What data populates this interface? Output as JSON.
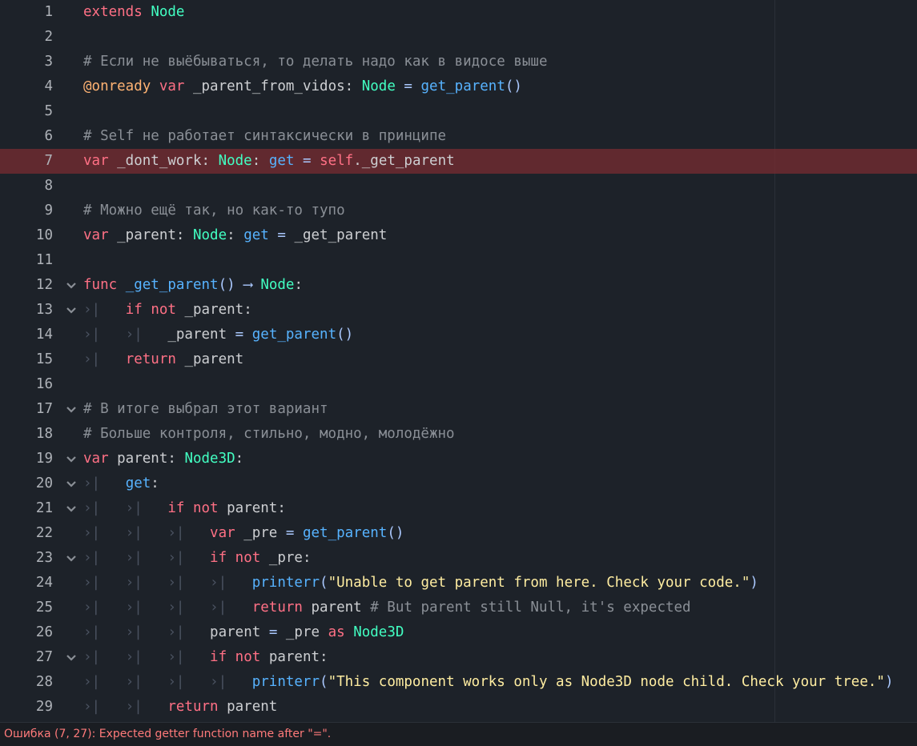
{
  "editor": {
    "lines": [
      {
        "num": "1",
        "fold": false,
        "error": false,
        "tokens": [
          [
            "kw",
            "extends"
          ],
          [
            "plain",
            " "
          ],
          [
            "type",
            "Node"
          ]
        ]
      },
      {
        "num": "2",
        "fold": false,
        "error": false,
        "tokens": []
      },
      {
        "num": "3",
        "fold": false,
        "error": false,
        "tokens": [
          [
            "cm",
            "# Если не выёбываться, то делать надо как в видосе выше"
          ]
        ]
      },
      {
        "num": "4",
        "fold": false,
        "error": false,
        "tokens": [
          [
            "anno",
            "@onready"
          ],
          [
            "plain",
            " "
          ],
          [
            "kw",
            "var"
          ],
          [
            "plain",
            " _parent_from_vidos: "
          ],
          [
            "type",
            "Node"
          ],
          [
            "plain",
            " "
          ],
          [
            "pn",
            "="
          ],
          [
            "plain",
            " "
          ],
          [
            "fn",
            "get_parent"
          ],
          [
            "pn",
            "()"
          ]
        ]
      },
      {
        "num": "5",
        "fold": false,
        "error": false,
        "tokens": []
      },
      {
        "num": "6",
        "fold": false,
        "error": false,
        "tokens": [
          [
            "cm",
            "# Self не работает синтаксически в принципе"
          ]
        ]
      },
      {
        "num": "7",
        "fold": false,
        "error": true,
        "tokens": [
          [
            "kw",
            "var"
          ],
          [
            "plain",
            " _dont_work: "
          ],
          [
            "type",
            "Node"
          ],
          [
            "plain",
            ": "
          ],
          [
            "getkw",
            "get"
          ],
          [
            "plain",
            " "
          ],
          [
            "pn",
            "="
          ],
          [
            "plain",
            " "
          ],
          [
            "selfkw",
            "self"
          ],
          [
            "plain",
            "._get_parent"
          ]
        ]
      },
      {
        "num": "8",
        "fold": false,
        "error": false,
        "tokens": []
      },
      {
        "num": "9",
        "fold": false,
        "error": false,
        "tokens": [
          [
            "cm",
            "# Можно ещё так, но как-то тупо"
          ]
        ]
      },
      {
        "num": "10",
        "fold": false,
        "error": false,
        "tokens": [
          [
            "kw",
            "var"
          ],
          [
            "plain",
            " _parent: "
          ],
          [
            "type",
            "Node"
          ],
          [
            "plain",
            ": "
          ],
          [
            "getkw",
            "get"
          ],
          [
            "plain",
            " "
          ],
          [
            "pn",
            "="
          ],
          [
            "plain",
            " _get_parent"
          ]
        ]
      },
      {
        "num": "11",
        "fold": false,
        "error": false,
        "tokens": []
      },
      {
        "num": "12",
        "fold": true,
        "error": false,
        "tokens": [
          [
            "kw",
            "func"
          ],
          [
            "plain",
            " "
          ],
          [
            "fn",
            "_get_parent"
          ],
          [
            "pn",
            "()"
          ],
          [
            "plain",
            " "
          ],
          [
            "pn",
            "⟶"
          ],
          [
            "plain",
            " "
          ],
          [
            "type",
            "Node"
          ],
          [
            "plain",
            ":"
          ]
        ]
      },
      {
        "num": "13",
        "fold": true,
        "error": false,
        "tokens": [
          [
            "tab",
            "›|   "
          ],
          [
            "kw",
            "if"
          ],
          [
            "plain",
            " "
          ],
          [
            "kw",
            "not"
          ],
          [
            "plain",
            " _parent:"
          ]
        ]
      },
      {
        "num": "14",
        "fold": false,
        "error": false,
        "tokens": [
          [
            "tab",
            "›|   ›|   "
          ],
          [
            "plain",
            "_parent "
          ],
          [
            "pn",
            "="
          ],
          [
            "plain",
            " "
          ],
          [
            "fn",
            "get_parent"
          ],
          [
            "pn",
            "()"
          ]
        ]
      },
      {
        "num": "15",
        "fold": false,
        "error": false,
        "tokens": [
          [
            "tab",
            "›|   "
          ],
          [
            "kw",
            "return"
          ],
          [
            "plain",
            " _parent"
          ]
        ]
      },
      {
        "num": "16",
        "fold": false,
        "error": false,
        "tokens": []
      },
      {
        "num": "17",
        "fold": true,
        "error": false,
        "tokens": [
          [
            "cm",
            "# В итоге выбрал этот вариант"
          ]
        ]
      },
      {
        "num": "18",
        "fold": false,
        "error": false,
        "tokens": [
          [
            "cm",
            "# Больше контроля, стильно, модно, молодёжно"
          ]
        ]
      },
      {
        "num": "19",
        "fold": true,
        "error": false,
        "tokens": [
          [
            "kw",
            "var"
          ],
          [
            "plain",
            " parent: "
          ],
          [
            "type",
            "Node3D"
          ],
          [
            "plain",
            ":"
          ]
        ]
      },
      {
        "num": "20",
        "fold": true,
        "error": false,
        "tokens": [
          [
            "tab",
            "›|   "
          ],
          [
            "getkw",
            "get"
          ],
          [
            "plain",
            ":"
          ]
        ]
      },
      {
        "num": "21",
        "fold": true,
        "error": false,
        "tokens": [
          [
            "tab",
            "›|   ›|   "
          ],
          [
            "kw",
            "if"
          ],
          [
            "plain",
            " "
          ],
          [
            "kw",
            "not"
          ],
          [
            "plain",
            " parent:"
          ]
        ]
      },
      {
        "num": "22",
        "fold": false,
        "error": false,
        "tokens": [
          [
            "tab",
            "›|   ›|   ›|   "
          ],
          [
            "kw",
            "var"
          ],
          [
            "plain",
            " _pre "
          ],
          [
            "pn",
            "="
          ],
          [
            "plain",
            " "
          ],
          [
            "fn",
            "get_parent"
          ],
          [
            "pn",
            "()"
          ]
        ]
      },
      {
        "num": "23",
        "fold": true,
        "error": false,
        "tokens": [
          [
            "tab",
            "›|   ›|   ›|   "
          ],
          [
            "kw",
            "if"
          ],
          [
            "plain",
            " "
          ],
          [
            "kw",
            "not"
          ],
          [
            "plain",
            " _pre:"
          ]
        ]
      },
      {
        "num": "24",
        "fold": false,
        "error": false,
        "tokens": [
          [
            "tab",
            "›|   ›|   ›|   ›|   "
          ],
          [
            "fn",
            "printerr"
          ],
          [
            "pn",
            "("
          ],
          [
            "str",
            "\"Unable to get parent from here. Check your code.\""
          ],
          [
            "pn",
            ")"
          ]
        ]
      },
      {
        "num": "25",
        "fold": false,
        "error": false,
        "tokens": [
          [
            "tab",
            "›|   ›|   ›|   ›|   "
          ],
          [
            "kw",
            "return"
          ],
          [
            "plain",
            " parent "
          ],
          [
            "cm",
            "# But parent still Null, it's expected"
          ]
        ]
      },
      {
        "num": "26",
        "fold": false,
        "error": false,
        "tokens": [
          [
            "tab",
            "›|   ›|   ›|   "
          ],
          [
            "plain",
            "parent "
          ],
          [
            "pn",
            "="
          ],
          [
            "plain",
            " _pre "
          ],
          [
            "kw",
            "as"
          ],
          [
            "plain",
            " "
          ],
          [
            "type",
            "Node3D"
          ]
        ]
      },
      {
        "num": "27",
        "fold": true,
        "error": false,
        "tokens": [
          [
            "tab",
            "›|   ›|   ›|   "
          ],
          [
            "kw",
            "if"
          ],
          [
            "plain",
            " "
          ],
          [
            "kw",
            "not"
          ],
          [
            "plain",
            " parent:"
          ]
        ]
      },
      {
        "num": "28",
        "fold": false,
        "error": false,
        "tokens": [
          [
            "tab",
            "›|   ›|   ›|   ›|   "
          ],
          [
            "fn",
            "printerr"
          ],
          [
            "pn",
            "("
          ],
          [
            "str",
            "\"This component works only as Node3D node child. Check your tree.\""
          ],
          [
            "pn",
            ")"
          ]
        ]
      },
      {
        "num": "29",
        "fold": false,
        "error": false,
        "tokens": [
          [
            "tab",
            "›|   ›|   "
          ],
          [
            "kw",
            "return"
          ],
          [
            "plain",
            " parent"
          ]
        ]
      }
    ]
  },
  "status": {
    "error_text": "Ошибка (7, 27): Expected getter function name after \"=\"."
  },
  "colors": {
    "background": "#1d2229",
    "keyword": "#ff7085",
    "type": "#42ffc2",
    "function": "#57b3ff",
    "annotation": "#ffb373",
    "string": "#ffeda1",
    "comment": "#8a8f96",
    "error_line": "#5a2a30",
    "error_text": "#ff7a7a"
  }
}
